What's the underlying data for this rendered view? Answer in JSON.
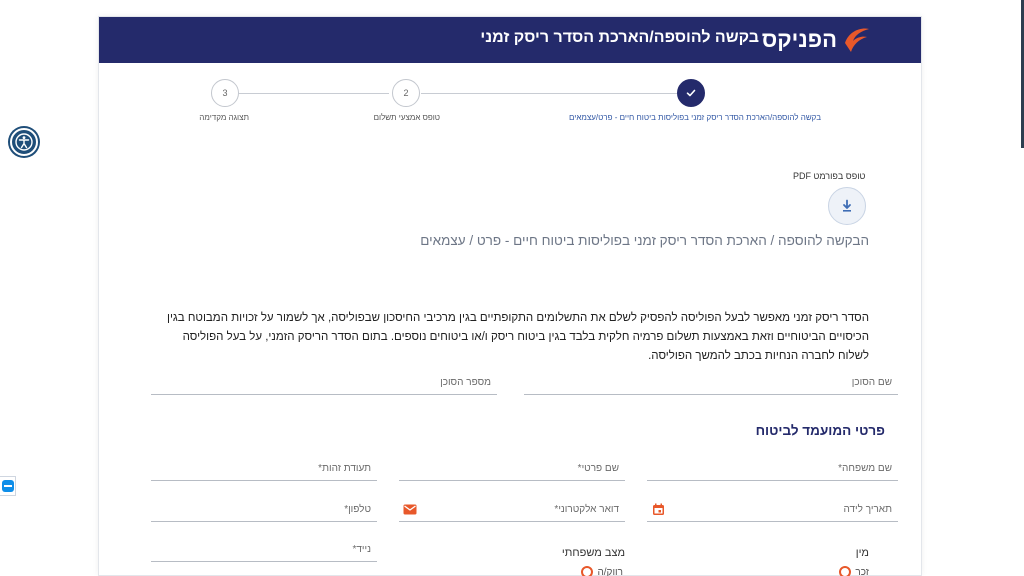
{
  "header": {
    "logo_text": "הפניקס",
    "title": "בקשה להוספה/הארכת הסדר ריסק זמני"
  },
  "stepper": {
    "steps": [
      {
        "label": "בקשה להוספה/הארכת הסדר ריסק זמני בפוליסות ביטוח חיים - פרט/עצמאים",
        "status": "completed"
      },
      {
        "label": "טופס אמצעי תשלום",
        "number": "2",
        "status": "pending"
      },
      {
        "label": "תצוגה מקדימה",
        "number": "3",
        "status": "pending"
      }
    ]
  },
  "pdf": {
    "label": "טופס בפורמט PDF",
    "icon": "download-icon"
  },
  "form_title": "הבקשה להוספה / הארכת הסדר ריסק זמני בפוליסות ביטוח חיים - פרט / עצמאים",
  "description": "הסדר ריסק זמני מאפשר לבעל הפוליסה להפסיק לשלם את התשלומים התקופתיים בגין מרכיבי החיסכון שבפוליסה, אך לשמור על זכויות המבוטח בגין הכיסויים הביטוחיים וזאת באמצעות תשלום פרמיה חלקית בלבד בגין ביטוח ריסק ו/או ביטוחים נוספים. בתום הסדר הריסק הזמני, על בעל הפוליסה לשלוח לחברה הנחיות בכתב להמשך הפוליסה.",
  "agent": {
    "name_label": "שם הסוכן",
    "number_label": "מספר הסוכן"
  },
  "insured": {
    "section_title": "פרטי המועמד לביטוח",
    "last_name_label": "שם משפחה*",
    "first_name_label": "שם פרטי*",
    "id_label": "תעודת זהות*",
    "birth_date_label": "תאריך לידה",
    "email_label": "דואר אלקטרוני*",
    "phone_label": "טלפון*",
    "gender_label": "מין",
    "gender_option": "זכר",
    "marital_label": "מצב משפחתי",
    "marital_option": "רווק/ה",
    "mobile_label": "נייד*"
  },
  "colors": {
    "header_bg": "#242a6b",
    "accent_orange": "#e8582a",
    "title_navy": "#242a6b",
    "link_blue": "#3157a4"
  }
}
